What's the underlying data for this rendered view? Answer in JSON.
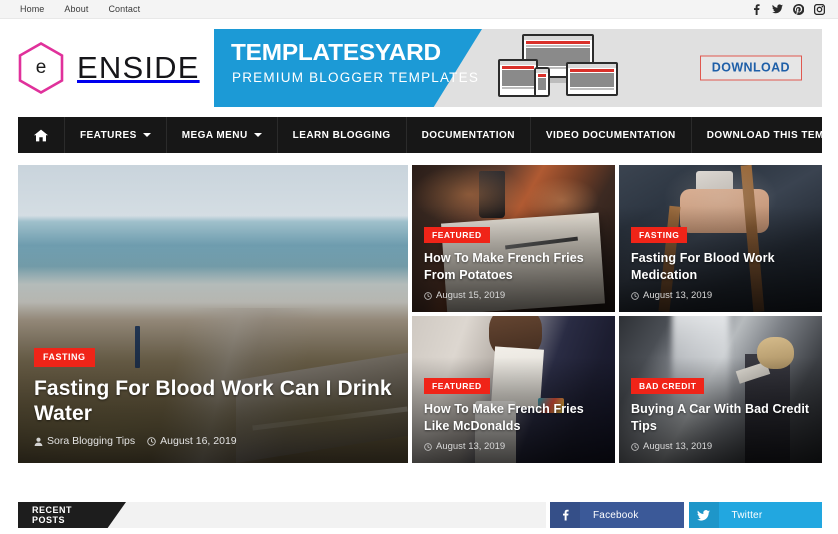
{
  "topbar": {
    "nav": [
      {
        "label": "Home"
      },
      {
        "label": "About"
      },
      {
        "label": "Contact"
      }
    ],
    "social": [
      {
        "name": "facebook-icon"
      },
      {
        "name": "twitter-icon"
      },
      {
        "name": "pinterest-icon"
      },
      {
        "name": "instagram-icon"
      }
    ]
  },
  "header": {
    "logo_letter": "e",
    "brand_name": "ENSIDE",
    "banner": {
      "title": "TEMPLATESYARD",
      "subtitle": "PREMIUM BLOGGER TEMPLATES",
      "download_label": "DOWNLOAD",
      "blue": "#1c9ad6",
      "download_border": "#e0584f",
      "download_text_color": "#1e5fa8"
    }
  },
  "mainnav": {
    "background": "#171717",
    "items": [
      {
        "label": "",
        "icon": "home-icon",
        "has_caret": false
      },
      {
        "label": "FEATURES",
        "has_caret": true
      },
      {
        "label": "MEGA MENU",
        "has_caret": true
      },
      {
        "label": "LEARN BLOGGING",
        "has_caret": false
      },
      {
        "label": "DOCUMENTATION",
        "has_caret": false
      },
      {
        "label": "VIDEO DOCUMENTATION",
        "has_caret": false
      },
      {
        "label": "DOWNLOAD THIS TEMPLATE",
        "has_caret": false
      }
    ],
    "search_icon": "search-icon"
  },
  "featured": {
    "badge_color": "#f02418",
    "main": {
      "badge": "FASTING",
      "title": "Fasting For Blood Work Can I Drink Water",
      "author": "Sora Blogging Tips",
      "date": "August 16, 2019",
      "image": "beach-boardwalk-photo"
    },
    "cards": [
      {
        "badge": "FEATURED",
        "title": "How To Make French Fries From Potatoes",
        "date": "August 15, 2019",
        "image": "notebook-on-desk-photo"
      },
      {
        "badge": "FASTING",
        "title": "Fasting For Blood Work Medication",
        "date": "August 13, 2019",
        "image": "person-holding-phone-backpack-photo"
      },
      {
        "badge": "FEATURED",
        "title": "How To Make French Fries Like McDonalds",
        "date": "August 13, 2019",
        "image": "man-in-suit-with-mug-photo"
      },
      {
        "badge": "BAD CREDIT",
        "title": "Buying A Car With Bad Credit Tips",
        "date": "August 13, 2019",
        "image": "woman-near-waterfall-photo"
      }
    ]
  },
  "bottom": {
    "recent_posts_label": "RECENT POSTS",
    "social_buttons": [
      {
        "label": "Facebook",
        "icon": "facebook-icon",
        "color": "#3b5998"
      },
      {
        "label": "Twitter",
        "icon": "twitter-icon",
        "color": "#22a7e0"
      }
    ]
  }
}
